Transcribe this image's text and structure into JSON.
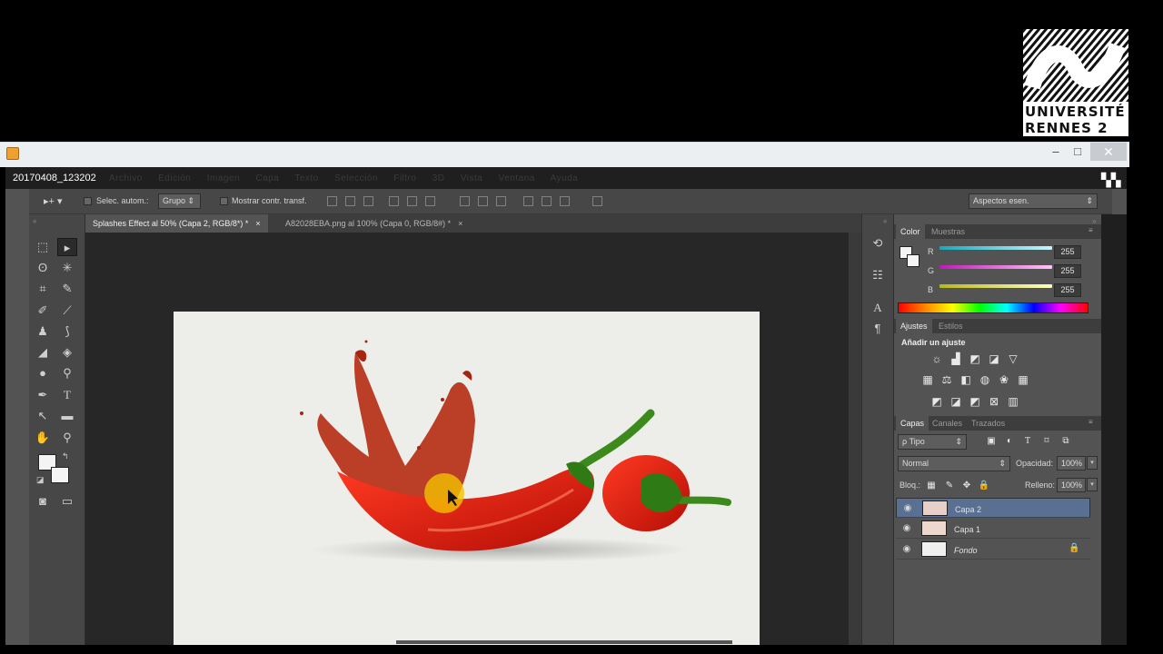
{
  "logo": {
    "line1": "UNIVERSITÉ",
    "line2": "RENNES 2"
  },
  "recorder": {
    "title": "20170408_123202",
    "minimize": "–",
    "maximize": "□",
    "close": "✕"
  },
  "menu": {
    "items": [
      "Archivo",
      "Edición",
      "Imagen",
      "Capa",
      "Texto",
      "Selección",
      "Filtro",
      "3D",
      "Vista",
      "Ventana",
      "Ayuda"
    ]
  },
  "options": {
    "auto_select_label": "Selec. autom.:",
    "auto_select_value": "Grupo",
    "transform_label": "Mostrar contr. transf.",
    "workspace": "Aspectos esen."
  },
  "tabs": [
    {
      "label": "Splashes Effect al 50% (Capa 2, RGB/8*) *",
      "close": "×"
    },
    {
      "label": "A82028EBA.png al 100% (Capa 0, RGB/8#) *",
      "close": "×"
    }
  ],
  "color_panel": {
    "tabs": [
      "Color",
      "Muestras"
    ],
    "r_label": "R",
    "r_value": "255",
    "g_label": "G",
    "g_value": "255",
    "b_label": "B",
    "b_value": "255",
    "colors": {
      "r": "#3fd6e8",
      "g": "#e84ad8",
      "b": "#e8e84a"
    }
  },
  "adjust_panel": {
    "tabs": [
      "Ajustes",
      "Estilos"
    ],
    "heading": "Añadir un ajuste"
  },
  "layers_panel": {
    "tabs": [
      "Capas",
      "Canales",
      "Trazados"
    ],
    "filter": "ρ Tipo",
    "blend_mode": "Normal",
    "opacity_label": "Opacidad:",
    "opacity_value": "100%",
    "lock_label": "Bloq.:",
    "fill_label": "Relleno:",
    "fill_value": "100%",
    "layers": [
      {
        "name": "Capa 2",
        "selected": true
      },
      {
        "name": "Capa 1",
        "selected": false
      },
      {
        "name": "Fondo",
        "selected": false
      }
    ]
  },
  "icons": {
    "lock": "🔒",
    "eye": "◉"
  }
}
